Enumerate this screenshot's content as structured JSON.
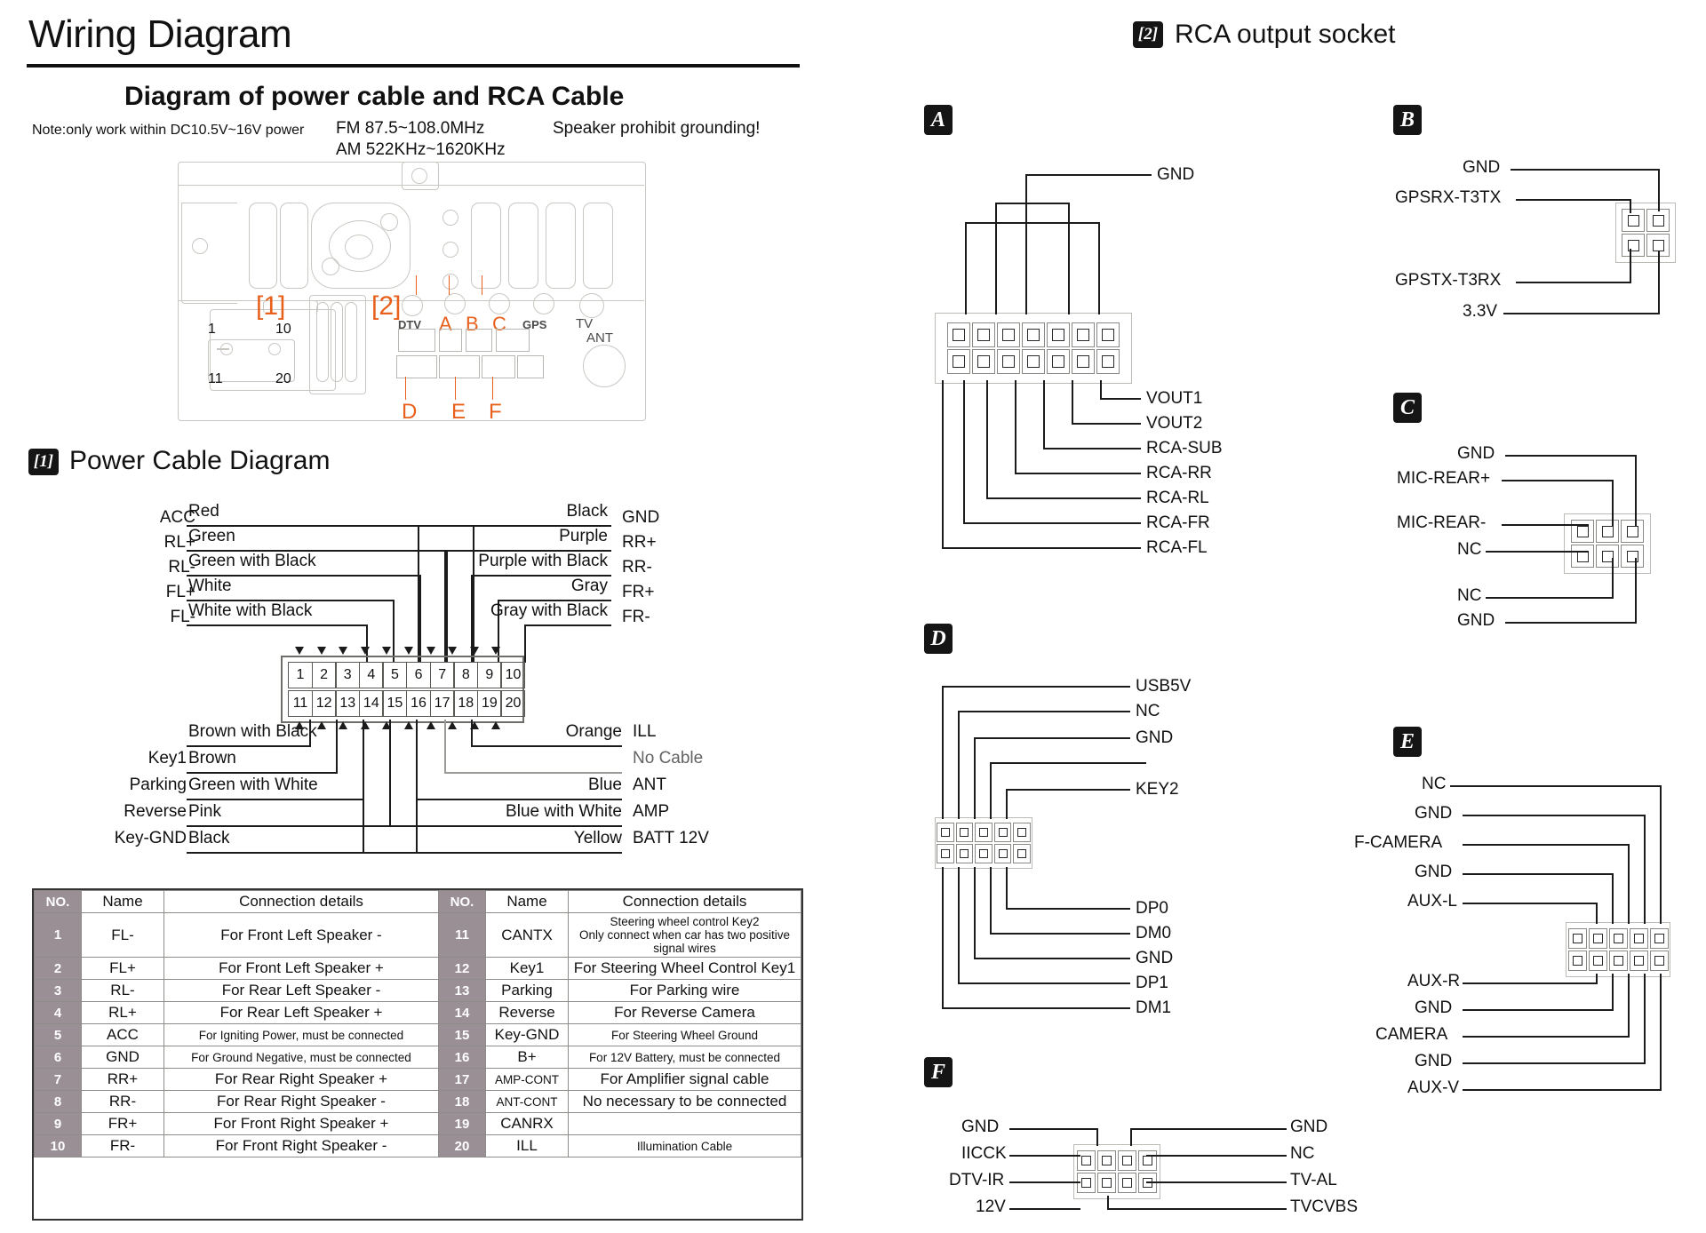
{
  "header": {
    "title": "Wiring Diagram",
    "subtitle": "Diagram of power cable and RCA Cable",
    "note": "Note:only work within DC10.5V~16V power",
    "fm": "FM  87.5~108.0MHz",
    "am": "AM  522KHz~1620KHz",
    "warning": "Speaker prohibit grounding!"
  },
  "device": {
    "tag1": "[1]",
    "tag2": "[2]",
    "left_pins": {
      "top_left": "1",
      "top_right": "10",
      "bottom_left": "11",
      "bottom_right": "20"
    },
    "socket_labels_top": [
      "DTV",
      "A",
      "B",
      "C",
      "GPS",
      "TV"
    ],
    "socket_labels_bottom": [
      "D",
      "E",
      "F"
    ],
    "ant_label": "ANT"
  },
  "power_section": {
    "badge": "[1]",
    "title": "Power Cable Diagram",
    "left_top": [
      {
        "pin": "ACC",
        "color": "Red"
      },
      {
        "pin": "RL+",
        "color": "Green"
      },
      {
        "pin": "RL-",
        "color": "Green with Black"
      },
      {
        "pin": "FL+",
        "color": "White"
      },
      {
        "pin": "FL-",
        "color": "White with Black"
      }
    ],
    "right_top": [
      {
        "color": "Black",
        "pin": "GND"
      },
      {
        "color": "Purple",
        "pin": "RR+"
      },
      {
        "color": "Purple with Black",
        "pin": "RR-"
      },
      {
        "color": "Gray",
        "pin": "FR+"
      },
      {
        "color": "Gray with Black",
        "pin": "FR-"
      }
    ],
    "left_bottom": [
      {
        "pin": "",
        "color": "Brown with Black"
      },
      {
        "pin": "Key1",
        "color": "Brown"
      },
      {
        "pin": "Parking",
        "color": "Green with White"
      },
      {
        "pin": "Reverse",
        "color": "Pink"
      },
      {
        "pin": "Key-GND",
        "color": "Black"
      }
    ],
    "right_bottom": [
      {
        "color": "Orange",
        "pin": "ILL"
      },
      {
        "color": "",
        "pin": "No Cable"
      },
      {
        "color": "Blue",
        "pin": "ANT"
      },
      {
        "color": "Blue with White",
        "pin": "AMP"
      },
      {
        "color": "Yellow",
        "pin": "BATT 12V"
      }
    ],
    "connector_top_numbers": [
      "1",
      "2",
      "3",
      "4",
      "5",
      "6",
      "7",
      "8",
      "9",
      "10"
    ],
    "connector_bottom_numbers": [
      "11",
      "12",
      "13",
      "14",
      "15",
      "16",
      "17",
      "18",
      "19",
      "20"
    ]
  },
  "connection_table": {
    "headers": [
      "NO.",
      "Name",
      "Connection details",
      "NO.",
      "Name",
      "Connection details"
    ],
    "rows": [
      {
        "no": "1",
        "name": "FL-",
        "details": "For Front Left Speaker -",
        "no2": "11",
        "name2": "CANTX",
        "details2": "Steering wheel control Key2\nOnly connect when car has two positive signal wires",
        "small2": true
      },
      {
        "no": "2",
        "name": "FL+",
        "details": "For Front Left Speaker +",
        "no2": "12",
        "name2": "Key1",
        "details2": "For Steering Wheel Control Key1"
      },
      {
        "no": "3",
        "name": "RL-",
        "details": "For Rear Left Speaker -",
        "no2": "13",
        "name2": "Parking",
        "details2": "For Parking wire"
      },
      {
        "no": "4",
        "name": "RL+",
        "details": "For Rear Left Speaker +",
        "no2": "14",
        "name2": "Reverse",
        "details2": "For Reverse Camera"
      },
      {
        "no": "5",
        "name": "ACC",
        "details": "For Igniting Power, must be connected",
        "small": true,
        "no2": "15",
        "name2": "Key-GND",
        "details2": "For Steering Wheel Ground",
        "small2": true
      },
      {
        "no": "6",
        "name": "GND",
        "details": "For Ground Negative, must be connected",
        "small": true,
        "no2": "16",
        "name2": "B+",
        "details2": "For 12V Battery, must be connected",
        "small2": true
      },
      {
        "no": "7",
        "name": "RR+",
        "details": "For Rear Right Speaker +",
        "no2": "17",
        "name2": "AMP-CONT",
        "details2": "For Amplifier signal cable",
        "nmsmall2": true
      },
      {
        "no": "8",
        "name": "RR-",
        "details": "For Rear Right Speaker -",
        "no2": "18",
        "name2": "ANT-CONT",
        "details2": "No necessary to be connected",
        "nmsmall2": true
      },
      {
        "no": "9",
        "name": "FR+",
        "details": "For Front Right Speaker +",
        "no2": "19",
        "name2": "CANRX",
        "details2": ""
      },
      {
        "no": "10",
        "name": "FR-",
        "details": "For Front Right Speaker -",
        "no2": "20",
        "name2": "ILL",
        "details2": "Illumination Cable",
        "small2": true
      }
    ]
  },
  "rca": {
    "badge": "[2]",
    "title": "RCA output socket",
    "connectors": [
      {
        "id": "A",
        "top_labels": [
          "GND"
        ],
        "bottom_labels": [
          "VOUT1",
          "VOUT2",
          "RCA-SUB",
          "RCA-RR",
          "RCA-RL",
          "RCA-FR",
          "RCA-FL"
        ]
      },
      {
        "id": "B",
        "left_labels": [
          "GND",
          "GPSRX-T3TX",
          "GPSTX-T3RX",
          "3.3V"
        ]
      },
      {
        "id": "C",
        "left_labels": [
          "GND",
          "MIC-REAR+",
          "MIC-REAR-",
          "NC",
          "NC",
          "GND"
        ]
      },
      {
        "id": "D",
        "right_labels": [
          "USB5V",
          "NC",
          "GND",
          "KEY2",
          "DP0",
          "DM0",
          "GND",
          "DP1",
          "DM1"
        ]
      },
      {
        "id": "E",
        "left_labels": [
          "NC",
          "GND",
          "F-CAMERA",
          "GND",
          "AUX-L",
          "AUX-R",
          "GND",
          "CAMERA",
          "GND",
          "AUX-V"
        ]
      },
      {
        "id": "F",
        "left_labels": [
          "GND",
          "IICCK",
          "DTV-IR",
          "12V"
        ],
        "right_labels": [
          "GND",
          "NC",
          "TV-AL",
          "TVCVBS"
        ]
      }
    ]
  },
  "colors": {
    "accent_orange": "#e8601c",
    "wire_black": "#1b1b1b",
    "no_cable_gray": "#9a9a96",
    "table_no_bg": "#9b8f96"
  }
}
